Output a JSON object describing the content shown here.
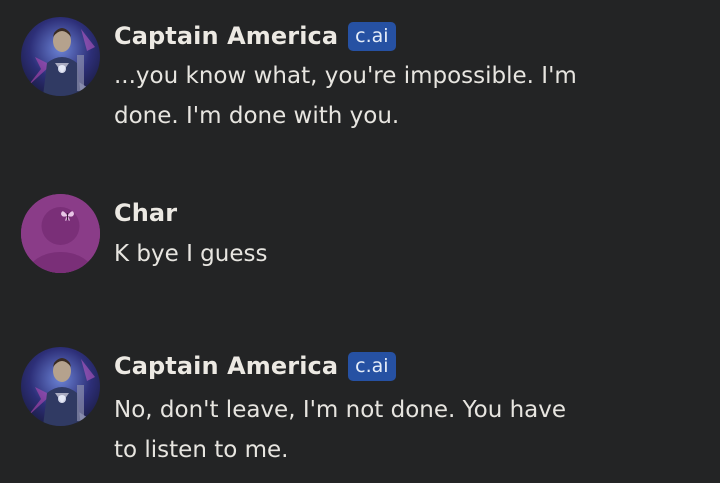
{
  "messages": [
    {
      "author": "Captain America",
      "badge": "c.ai",
      "text": "...you know what, you're impossible. I'm done. I'm done with you.",
      "avatar_icon": "captain-america-avatar"
    },
    {
      "author": "Char",
      "text": "K bye I guess",
      "avatar_icon": "default-user-avatar-with-butterfly",
      "avatar_color": "#8a3c88"
    },
    {
      "author": "Captain America",
      "badge": "c.ai",
      "text": "No, don't leave, I'm not done. You have to listen to me.",
      "avatar_icon": "captain-america-avatar"
    }
  ],
  "colors": {
    "background": "#232425",
    "badge": "#2651a3",
    "user_avatar": "#8a3c88"
  }
}
